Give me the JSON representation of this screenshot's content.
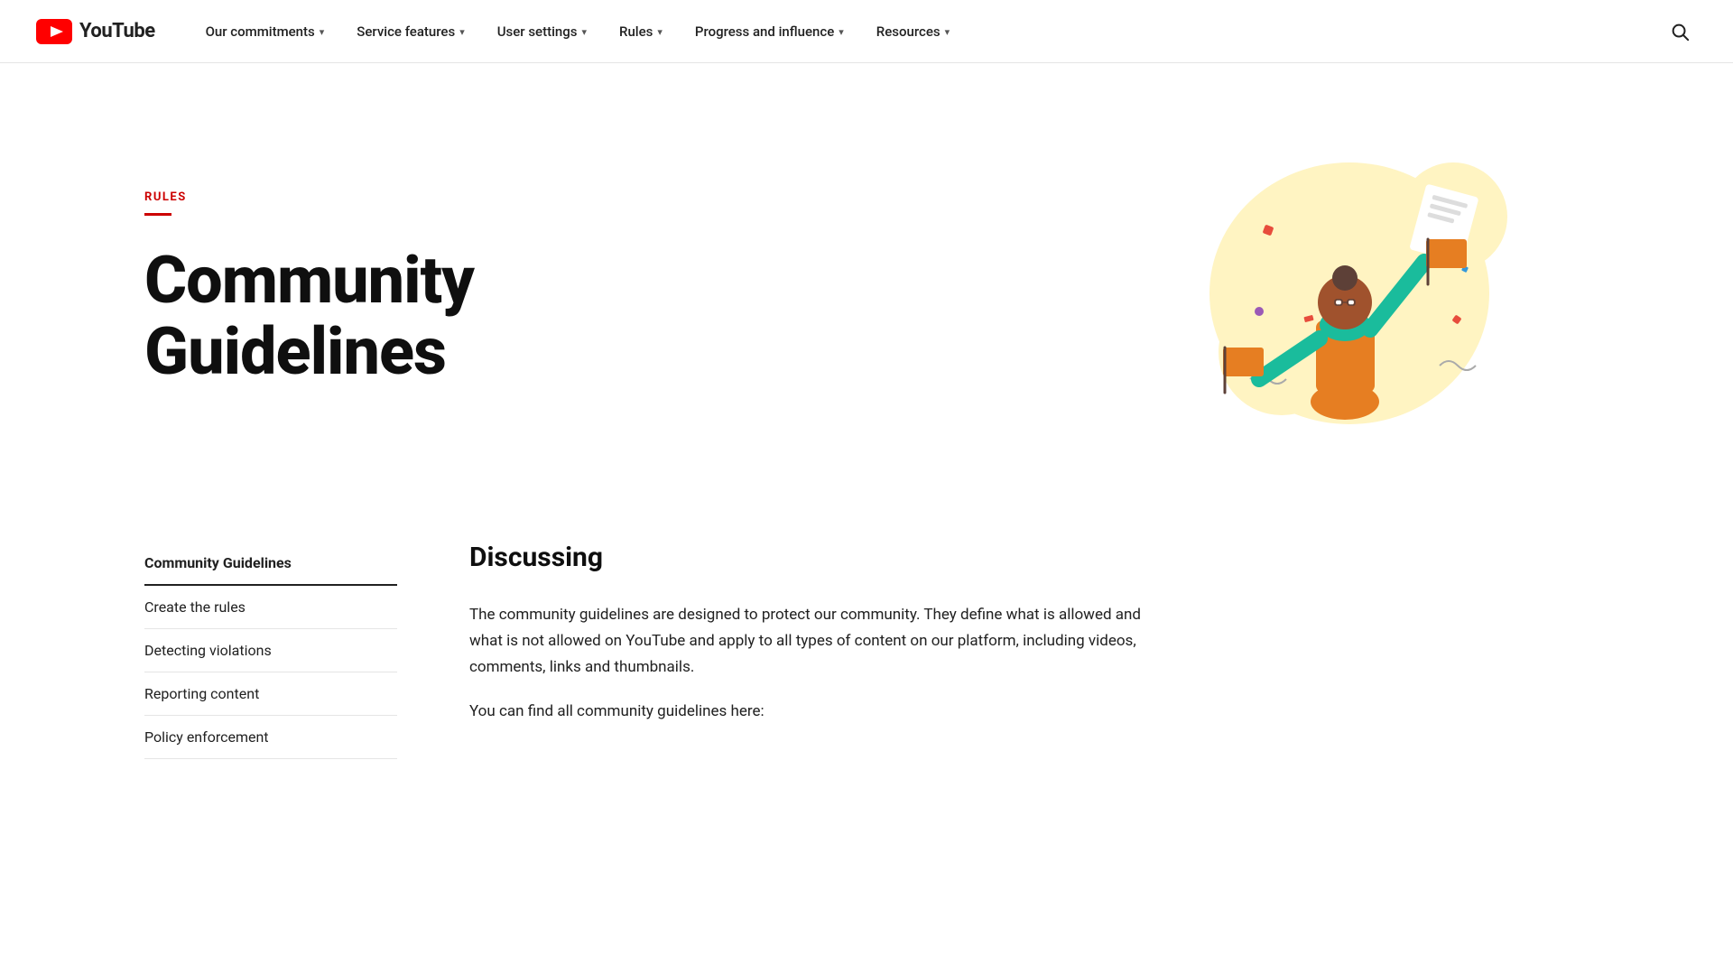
{
  "header": {
    "logo_text": "YouTube",
    "nav_items": [
      {
        "label": "Our commitments",
        "has_dropdown": true
      },
      {
        "label": "Service features",
        "has_dropdown": true
      },
      {
        "label": "User settings",
        "has_dropdown": true
      },
      {
        "label": "Rules",
        "has_dropdown": true
      },
      {
        "label": "Progress and influence",
        "has_dropdown": true
      },
      {
        "label": "Resources",
        "has_dropdown": true
      }
    ],
    "search_aria": "Search"
  },
  "hero": {
    "rules_label": "RULES",
    "title": "Community Guidelines"
  },
  "sidebar": {
    "items": [
      {
        "label": "Community Guidelines",
        "active": true
      },
      {
        "label": "Create the rules",
        "active": false
      },
      {
        "label": "Detecting violations",
        "active": false
      },
      {
        "label": "Reporting content",
        "active": false
      },
      {
        "label": "Policy enforcement",
        "active": false
      }
    ]
  },
  "article": {
    "section_title": "Discussing",
    "paragraphs": [
      "The community guidelines are designed to protect our community. They define what is allowed and what is not allowed on YouTube and apply to all types of content on our platform, including videos, comments, links and thumbnails.",
      "You can find all community guidelines here:"
    ]
  },
  "icons": {
    "chevron": "▾",
    "search": "🔍"
  }
}
